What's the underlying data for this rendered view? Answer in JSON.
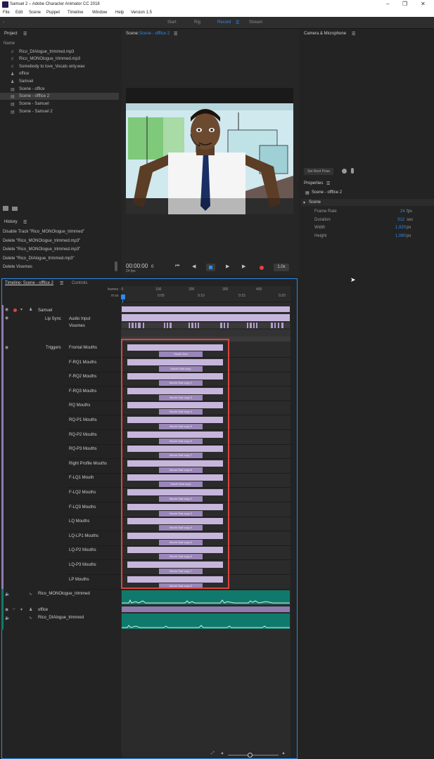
{
  "window": {
    "title": "Samuel 2 – Adobe Character Animator CC 2018"
  },
  "menu": [
    "File",
    "Edit",
    "Scene",
    "Puppet",
    "Timeline",
    "Window",
    "Help",
    "Version 1.5"
  ],
  "workspaces": [
    "Start",
    "Rig",
    "Record",
    "Stream"
  ],
  "project": {
    "title": "Project",
    "name_header": "Name",
    "items": [
      {
        "icon": "audio-icon",
        "label": "Rico_DIAlogue_trimmed.mp3"
      },
      {
        "icon": "audio-icon",
        "label": "Rico_MONOlogue_trimmed.mp3"
      },
      {
        "icon": "audio-icon",
        "label": "Somebody to love_Vocals only.wav"
      },
      {
        "icon": "puppet-icon",
        "label": "office"
      },
      {
        "icon": "puppet-icon",
        "label": "Samuel"
      },
      {
        "icon": "scene-icon",
        "label": "Scene - office"
      },
      {
        "icon": "scene-icon",
        "label": "Scene - offfice 2"
      },
      {
        "icon": "scene-icon",
        "label": "Scene - Samuel"
      },
      {
        "icon": "scene-icon",
        "label": "Scene - Samuel 2"
      }
    ]
  },
  "history": {
    "title": "History",
    "items": [
      "Disable Track \"Rico_MONOlogue_trimmed\"",
      "Delete \"Rico_MONOlogue_trimmed.mp3\"",
      "Delete \"Rico_MONOlogue_trimmed.mp3\"",
      "Delete \"Rico_DIAlogue_trimmed.mp3\"",
      "Delete Visemes"
    ]
  },
  "scene": {
    "label": "Scene:",
    "name": "Scene - offfice 2",
    "timecode": "00:00:00",
    "frame": "0",
    "fps": "24 fps",
    "zoom": "1.0x"
  },
  "camera": {
    "title": "Camera & Microphone",
    "rest_pose": "Set Rest Pose"
  },
  "properties": {
    "title": "Properties",
    "scene_name": "Scene - offfice 2",
    "section": "Scene",
    "rows": [
      {
        "label": "Frame Rate",
        "value": "24",
        "unit": "fps"
      },
      {
        "label": "Duration",
        "value": "312",
        "unit": "sec"
      },
      {
        "label": "Width",
        "value": "1,920",
        "unit": "px"
      },
      {
        "label": "Height",
        "value": "1,080",
        "unit": "px"
      }
    ]
  },
  "timeline": {
    "tab_title": "Timeline: Scene - offfice 2",
    "controls_tab": "Controls",
    "ruler_frames_label": "frames : 0",
    "ruler_frames": [
      "100",
      "200",
      "300",
      "400"
    ],
    "ruler_time_label": "m:ss",
    "ruler_times": [
      "0:05",
      "0:10",
      "0:15",
      "0:20"
    ],
    "puppet": "Samuel",
    "lipsync": "Lip Sync",
    "audio_input": "Audio Input",
    "visemes": "Visemes",
    "triggers": "Triggers",
    "trigger_rows": [
      "Frontal Mouths",
      "F-RQ1 Mouths",
      "F-RQ2 Mouths",
      "F-RQ3 Mouths",
      "RQ Mouths",
      "RQ-P1 Mouths",
      "RQ-P2 Mouths",
      "RQ-P3 Mouths",
      "Right Profile Mouths",
      "F-LQ1 Mouth",
      "F-LQ2 Mouths",
      "F-LQ3 Mouths",
      "LQ Mouths",
      "LQ-LP1 Mouths",
      "LQ-P2 Mouths",
      "LQ-P3 Mouths",
      "LP Mouths"
    ],
    "clip_labels": [
      "Mouth Sad",
      "Mouth Sad copy",
      "Mouth Sad copy 2",
      "Mouth Sad copy 3",
      "Mouth Sad copy 4",
      "Mouth Sad copy 5",
      "Mouth Sad copy 6",
      "Mouth Sad copy 7",
      "Mouth Sad copy 8",
      "Mouth Sad copy",
      "Mouth Sad copy 2",
      "Mouth Sad copy 3",
      "Mouth Sad copy 4",
      "Mouth Sad copy 5",
      "Mouth Sad copy 6",
      "Mouth Sad copy 7",
      "Mouth Sad copy 9"
    ],
    "audio_track_1": "Rico_MONOlogue_trimmed",
    "puppet_2": "office",
    "audio_track_2": "Rico_DIAlogue_trimmed"
  },
  "colors": {
    "accent": "#2d8ceb",
    "highlight": "#e0433c",
    "clip": "#c7b6dc",
    "audio": "#0f7a6c"
  }
}
